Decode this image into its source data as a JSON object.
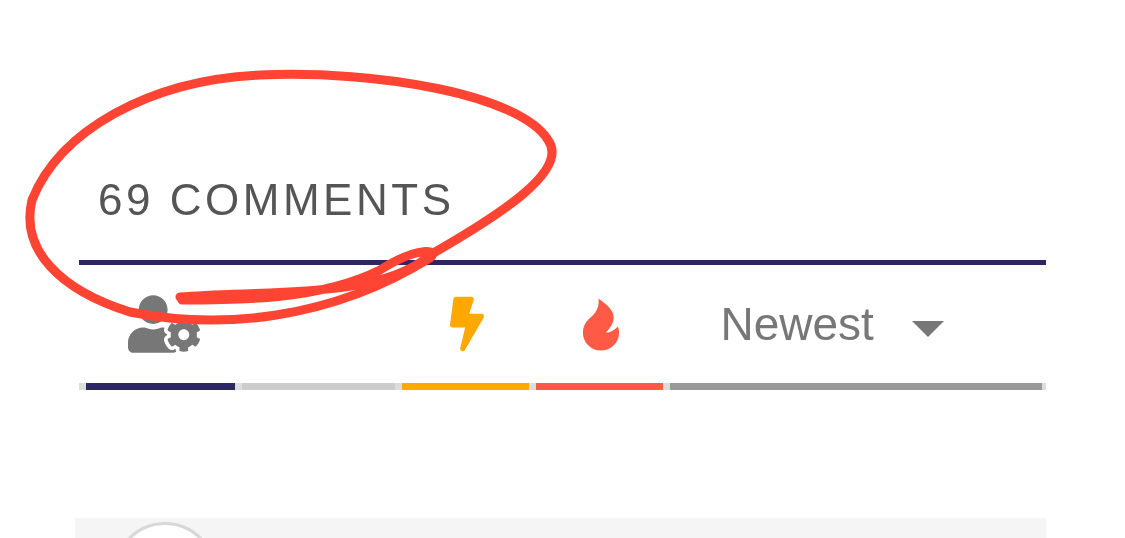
{
  "comments": {
    "heading": "69 COMMENTS",
    "tabs": [
      {
        "kind": "user-settings",
        "color": "#2e2860"
      },
      {
        "kind": "blank",
        "color": "#cccccc"
      },
      {
        "kind": "bolt",
        "color": "#ffa800"
      },
      {
        "kind": "flame",
        "color": "#ff5a45"
      },
      {
        "kind": "sort",
        "label": "Newest",
        "color": "#999999"
      }
    ]
  }
}
